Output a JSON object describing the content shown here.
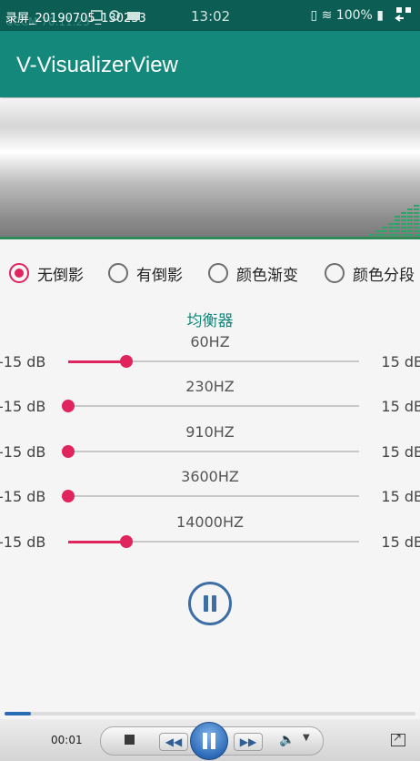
{
  "status_bar": {
    "recording_overlay": "录屏_20190705_130233",
    "faded_text": "CCCM 70.11.23",
    "time": "13:02",
    "battery": "100%",
    "icons": [
      "image-icon",
      "sync-icon",
      "video-icon",
      "signal-icon",
      "wifi-icon",
      "battery-icon"
    ]
  },
  "toolbar": {
    "title": "V-VisualizerView"
  },
  "visualizer": {
    "accent": "#2fa36a",
    "levels": [
      2,
      3,
      4,
      5,
      7,
      8,
      9,
      10
    ]
  },
  "radio_options": [
    {
      "label": "无倒影",
      "selected": true
    },
    {
      "label": "有倒影",
      "selected": false
    },
    {
      "label": "颜色渐变",
      "selected": false
    },
    {
      "label": "颜色分段",
      "selected": false
    }
  ],
  "equalizer": {
    "title": "均衡器",
    "bands": [
      {
        "freq": "60HZ",
        "min": "-15 dB",
        "max": "15 dB",
        "level": 0.1
      },
      {
        "freq": "230HZ",
        "min": "-15 dB",
        "max": "15 dB",
        "level": 0.0
      },
      {
        "freq": "910HZ",
        "min": "-15 dB",
        "max": "15 dB",
        "level": 0.0
      },
      {
        "freq": "3600HZ",
        "min": "-15 dB",
        "max": "15 dB",
        "level": 0.0
      },
      {
        "freq": "14000HZ",
        "min": "-15 dB",
        "max": "15 dB",
        "level": 0.1
      }
    ]
  },
  "player": {
    "elapsed": "00:01",
    "progress": 0.065,
    "accent": "#2a6bb5"
  },
  "colors": {
    "primary": "#13887b",
    "accent": "#e0245e",
    "control": "#3d6ea6"
  }
}
